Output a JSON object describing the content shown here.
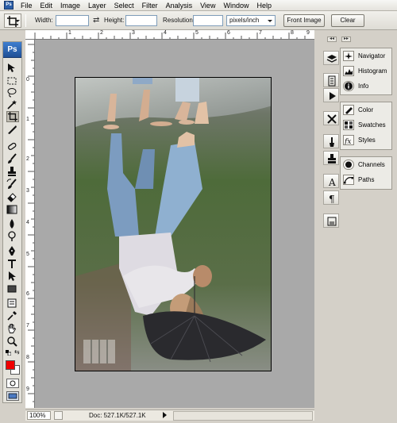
{
  "menu": {
    "app_icon": "Ps",
    "items": [
      "File",
      "Edit",
      "Image",
      "Layer",
      "Select",
      "Filter",
      "Analysis",
      "View",
      "Window",
      "Help"
    ]
  },
  "options_bar": {
    "tool_icon": "crop-icon",
    "width_label": "Width:",
    "width_value": "",
    "height_label": "Height:",
    "height_value": "",
    "resolution_label": "Resolution:",
    "resolution_value": "",
    "resolution_unit": "pixels/inch",
    "front_image_button": "Front Image",
    "clear_button": "Clear"
  },
  "toolbox": {
    "logo": "Ps",
    "tools": [
      "move-icon",
      "marquee-icon",
      "lasso-icon",
      "magic-wand-icon",
      "crop-icon",
      "slice-icon",
      "healing-brush-icon",
      "brush-icon",
      "clone-stamp-icon",
      "history-brush-icon",
      "eraser-icon",
      "gradient-icon",
      "blur-icon",
      "dodge-icon",
      "pen-icon",
      "type-icon",
      "path-selection-icon",
      "rectangle-icon",
      "notes-icon",
      "eyedropper-icon",
      "hand-icon",
      "zoom-icon"
    ],
    "active_tool": "crop-icon",
    "foreground_color": "#f00000",
    "background_color": "#ffffff"
  },
  "rulers": {
    "h_ticks": [
      "1",
      "2",
      "3",
      "4",
      "5",
      "6",
      "7",
      "8",
      "9"
    ],
    "v_ticks": [
      "0",
      "1",
      "2",
      "3",
      "4",
      "5",
      "6",
      "7",
      "8",
      "9"
    ]
  },
  "status": {
    "zoom": "100%",
    "doc_info": "Doc: 527.1K/527.1K"
  },
  "panels": {
    "group1": [
      "Navigator",
      "Histogram",
      "Info"
    ],
    "group2": [
      "Color",
      "Swatches",
      "Styles"
    ],
    "group3": [
      "Channels",
      "Paths"
    ]
  },
  "colors": {
    "foreground": "#f00000",
    "accent_ps": "#2c5fa8"
  }
}
